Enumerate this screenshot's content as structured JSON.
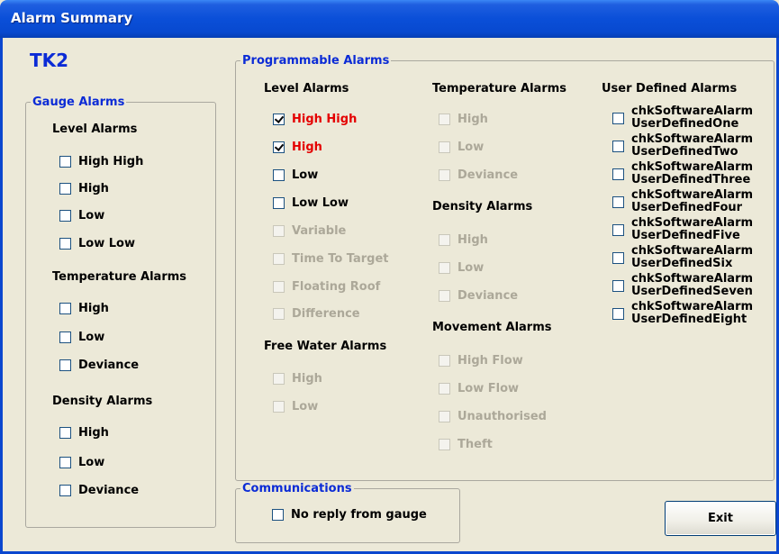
{
  "window": {
    "title": "Alarm Summary"
  },
  "tank": "TK2",
  "gauge": {
    "legend": "Gauge Alarms",
    "groups": [
      {
        "heading": "Level Alarms",
        "items": [
          "High High",
          "High",
          "Low",
          "Low Low"
        ]
      },
      {
        "heading": "Temperature Alarms",
        "items": [
          "High",
          "Low",
          "Deviance"
        ]
      },
      {
        "heading": "Density Alarms",
        "items": [
          "High",
          "Low",
          "Deviance"
        ]
      }
    ]
  },
  "programmable": {
    "legend": "Programmable Alarms",
    "level": {
      "heading": "Level Alarms",
      "items": [
        {
          "label": "High High",
          "checked": true,
          "state": "alert"
        },
        {
          "label": "High",
          "checked": true,
          "state": "alert"
        },
        {
          "label": "Low",
          "checked": false,
          "state": "enabled"
        },
        {
          "label": "Low Low",
          "checked": false,
          "state": "enabled"
        },
        {
          "label": "Variable",
          "checked": false,
          "state": "disabled"
        },
        {
          "label": "Time To Target",
          "checked": false,
          "state": "disabled"
        },
        {
          "label": "Floating Roof",
          "checked": false,
          "state": "disabled"
        },
        {
          "label": "Difference",
          "checked": false,
          "state": "disabled"
        }
      ]
    },
    "free_water": {
      "heading": "Free Water Alarms",
      "items": [
        "High",
        "Low"
      ]
    },
    "temperature": {
      "heading": "Temperature Alarms",
      "items": [
        "High",
        "Low",
        "Deviance"
      ]
    },
    "density": {
      "heading": "Density Alarms",
      "items": [
        "High",
        "Low",
        "Deviance"
      ]
    },
    "movement": {
      "heading": "Movement Alarms",
      "items": [
        "High Flow",
        "Low Flow",
        "Unauthorised",
        "Theft"
      ]
    },
    "user_defined": {
      "heading": "User Defined Alarms",
      "items": [
        {
          "line1": "chkSoftwareAlarm",
          "line2": "UserDefinedOne"
        },
        {
          "line1": "chkSoftwareAlarm",
          "line2": "UserDefinedTwo"
        },
        {
          "line1": "chkSoftwareAlarm",
          "line2": "UserDefinedThree"
        },
        {
          "line1": "chkSoftwareAlarm",
          "line2": "UserDefinedFour"
        },
        {
          "line1": "chkSoftwareAlarm",
          "line2": "UserDefinedFive"
        },
        {
          "line1": "chkSoftwareAlarm",
          "line2": "UserDefinedSix"
        },
        {
          "line1": "chkSoftwareAlarm",
          "line2": "UserDefinedSeven"
        },
        {
          "line1": "chkSoftwareAlarm",
          "line2": "UserDefinedEight"
        }
      ]
    }
  },
  "communications": {
    "legend": "Communications",
    "items": [
      "No reply from gauge"
    ]
  },
  "buttons": {
    "exit": "Exit"
  },
  "colors": {
    "accent": "#0b2bd6",
    "alert": "#e40000",
    "titlebar": "#0a4fd8",
    "disabled": "#aca899"
  }
}
